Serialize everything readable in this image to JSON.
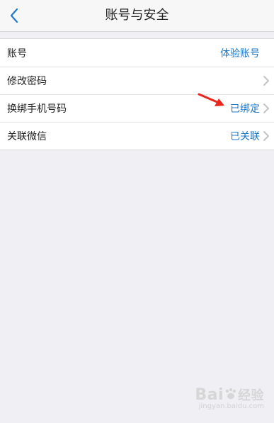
{
  "nav": {
    "title": "账号与安全",
    "back_icon": "chevron-left-icon",
    "accent_color": "#1f78c8"
  },
  "rows": [
    {
      "label": "账号",
      "value": "体验账号",
      "chevron": false
    },
    {
      "label": "修改密码",
      "value": "",
      "chevron": true
    },
    {
      "label": "换绑手机号码",
      "value": "已绑定",
      "chevron": true
    },
    {
      "label": "关联微信",
      "value": "已关联",
      "chevron": true
    }
  ],
  "annotation": {
    "icon": "red-arrow-icon",
    "color": "#e8261c"
  },
  "watermark": {
    "brand": "Bai",
    "brand2": "经验",
    "sub": "jingyan.baidu.com"
  }
}
